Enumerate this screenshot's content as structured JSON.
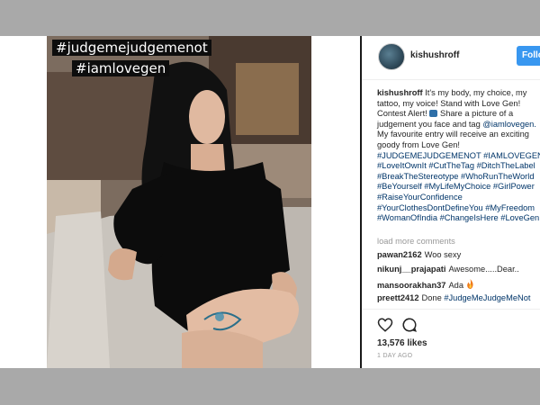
{
  "photo": {
    "overlay_line1": "#judgemejudgemenot",
    "overlay_line2": "#iamlovegen"
  },
  "post": {
    "username": "kishushroff",
    "follow_label": "Follow",
    "caption_user": "kishushroff",
    "caption_text_1": "It's my body, my choice, my tattoo, my voice! Stand with Love Gen! Contest Alert!",
    "caption_text_2": "Share a picture of a judgement you face and tag",
    "caption_mention": "@iamlovegen.",
    "caption_text_3": "My favourite entry will receive an exciting goody from Love Gen!",
    "caption_tags": "#JUDGEMEJUDGEMENOT #IAMLOVEGEN #LoveItOwnIt #CutTheTag #DitchTheLabel #BreakTheStereotype #WhoRunTheWorld #BeYourself #MyLifeMyChoice #GirlPower #RaiseYourConfidence #YourClothesDontDefineYou #MyFreedom #WomanOfIndia #ChangeIsHere #LoveGen"
  },
  "comments": {
    "load_more": "load more comments",
    "items": [
      {
        "user": "pawan2162",
        "text": "Woo sexy"
      },
      {
        "user": "nikunj__prajapati",
        "text": "Awesome.....Dear.."
      },
      {
        "user": "mansoorakhan37",
        "text": "Ada"
      },
      {
        "user": "preett2412",
        "text": "Done",
        "tag": "#JudgeMeJudgeMeNot"
      }
    ]
  },
  "engagement": {
    "likes": "13,576 likes",
    "time": "1 DAY AGO"
  },
  "icons": [
    "heart-icon",
    "comment-icon",
    "avatar",
    "camera-emoji-icon",
    "fire-emoji-icon"
  ],
  "colors": {
    "follow_button": "#3897f0",
    "link": "#003569",
    "muted": "#999999"
  }
}
